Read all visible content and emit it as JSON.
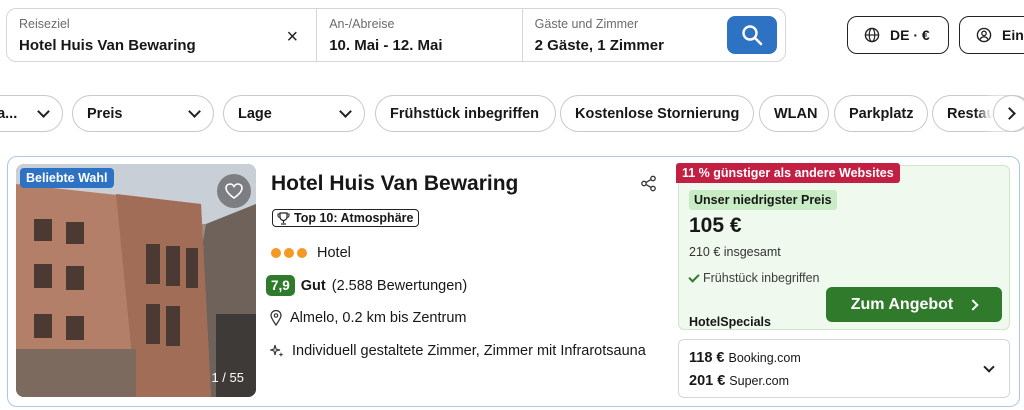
{
  "search": {
    "destination_label": "Reiseziel",
    "destination_value": "Hotel Huis Van Bewaring",
    "clear_icon": "×",
    "dates_label": "An-/Abreise",
    "dates_value": "10. Mai - 12. Mai",
    "guests_label": "Gäste und Zimmer",
    "guests_value": "2 Gäste, 1 Zimmer"
  },
  "header": {
    "locale_label": "DE · €",
    "login_label": "Ein"
  },
  "filters": [
    "...a...",
    "Preis",
    "Lage",
    "Frühstück inbegriffen",
    "Kostenlose Stornierung",
    "WLAN",
    "Parkplatz",
    "Restau"
  ],
  "hotel": {
    "badge": "Beliebte Wahl",
    "photo_counter": "1 / 55",
    "name": "Hotel Huis Van Bewaring",
    "top10": "Top 10: Atmosphäre",
    "stars": 3,
    "type": "Hotel",
    "score": "7,9",
    "rating_word": "Gut",
    "reviews": "(2.588 Bewertungen)",
    "location": "Almelo, 0.2 km bis Zentrum",
    "features": "Individuell gestaltete Zimmer, Zimmer mit Infrarotsauna"
  },
  "deal": {
    "cheaper_badge": "11 % günstiger als andere Websites",
    "lowest_label": "Unser niedrigster Preis",
    "price": "105 €",
    "total": "210 € insgesamt",
    "breakfast": "Frühstück inbegriffen",
    "provider": "HotelSpecials",
    "button": "Zum Angebot"
  },
  "alternatives": [
    {
      "price": "118 €",
      "site": "Booking.com"
    },
    {
      "price": "201 €",
      "site": "Super.com"
    }
  ],
  "colors": {
    "accent_blue": "#2d72c3",
    "deal_green": "#2f7a2b",
    "badge_red": "#c21f43",
    "star_orange": "#f39a26"
  }
}
